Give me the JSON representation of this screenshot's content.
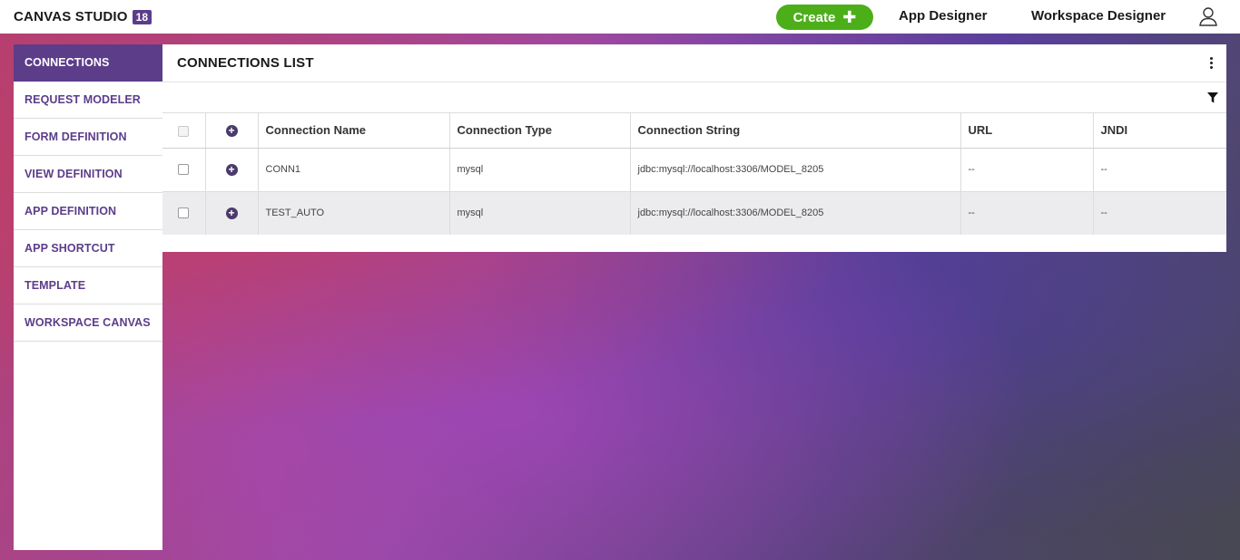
{
  "brand": {
    "name": "CANVAS STUDIO",
    "version_badge": "18"
  },
  "topnav": {
    "create_label": "Create",
    "create_icon": "plus-icon",
    "app_designer": "App Designer",
    "workspace_designer": "Workspace Designer",
    "user_icon": "user-icon"
  },
  "sidebar": {
    "items": [
      {
        "label": "CONNECTIONS",
        "active": true
      },
      {
        "label": "REQUEST MODELER"
      },
      {
        "label": "FORM DEFINITION"
      },
      {
        "label": "VIEW DEFINITION"
      },
      {
        "label": "APP DEFINITION"
      },
      {
        "label": "APP SHORTCUT"
      },
      {
        "label": "TEMPLATE"
      },
      {
        "label": "WORKSPACE CANVAS"
      }
    ]
  },
  "panel": {
    "title": "CONNECTIONS LIST",
    "menu_icon": "kebab-menu-icon",
    "filter_icon": "filter-icon"
  },
  "table": {
    "columns": [
      "Connection Name",
      "Connection Type",
      "Connection String",
      "URL",
      "JNDI"
    ],
    "rows": [
      {
        "name": "CONN1",
        "type": "mysql",
        "conn_string": "jdbc:mysql://localhost:3306/MODEL_8205",
        "url": "--",
        "jndi": "--"
      },
      {
        "name": "TEST_AUTO",
        "type": "mysql",
        "conn_string": "jdbc:mysql://localhost:3306/MODEL_8205",
        "url": "--",
        "jndi": "--"
      }
    ]
  },
  "colors": {
    "accent_purple": "#5c3d8a",
    "create_green": "#4caf1a"
  }
}
